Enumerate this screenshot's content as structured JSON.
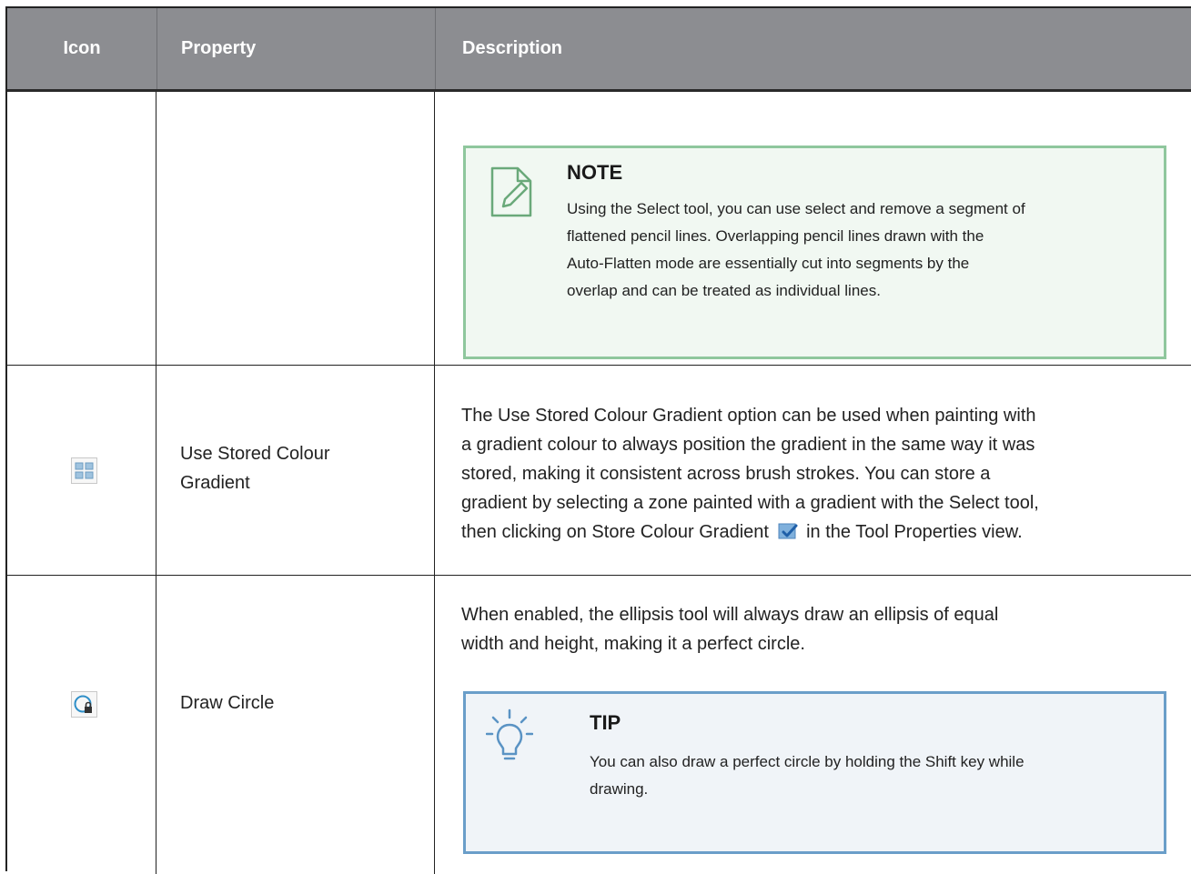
{
  "table": {
    "headers": {
      "icon": "Icon",
      "property": "Property",
      "description": "Description"
    },
    "rows": [
      {
        "property": "",
        "note": {
          "title": "NOTE",
          "lines": [
            "Using the Select tool, you can use select and remove a segment of",
            "flattened pencil lines. Overlapping pencil lines drawn with the",
            "Auto-Flatten mode are essentially cut into segments by the",
            "overlap and can be treated as individual lines."
          ]
        }
      },
      {
        "icon": "stored-colour-gradient-icon",
        "property_lines": [
          "Use Stored Colour",
          "Gradient"
        ],
        "description_lines": [
          "The Use Stored Colour Gradient option can be used when painting with",
          "a gradient colour to always position the gradient in the same way it was",
          "stored, making it consistent across brush strokes. You can store a",
          "gradient by selecting a zone painted with a gradient with the Select tool,"
        ],
        "description_last_before": "then clicking on Store Colour Gradient",
        "description_last_after": "in the Tool Properties view."
      },
      {
        "icon": "draw-circle-icon",
        "property": "Draw Circle",
        "description_lines": [
          "When enabled, the ellipsis tool will always draw an ellipsis of equal",
          "width and height, making it a perfect circle."
        ],
        "tip": {
          "title": "TIP",
          "lines": [
            "You can also draw a perfect circle by holding the Shift key while",
            "drawing."
          ]
        }
      }
    ]
  },
  "colors": {
    "header_bg": "#8c8d91",
    "note_border": "#8fc79d",
    "tip_border": "#6a9ec9",
    "icon_blue": "#3a8fc4"
  }
}
